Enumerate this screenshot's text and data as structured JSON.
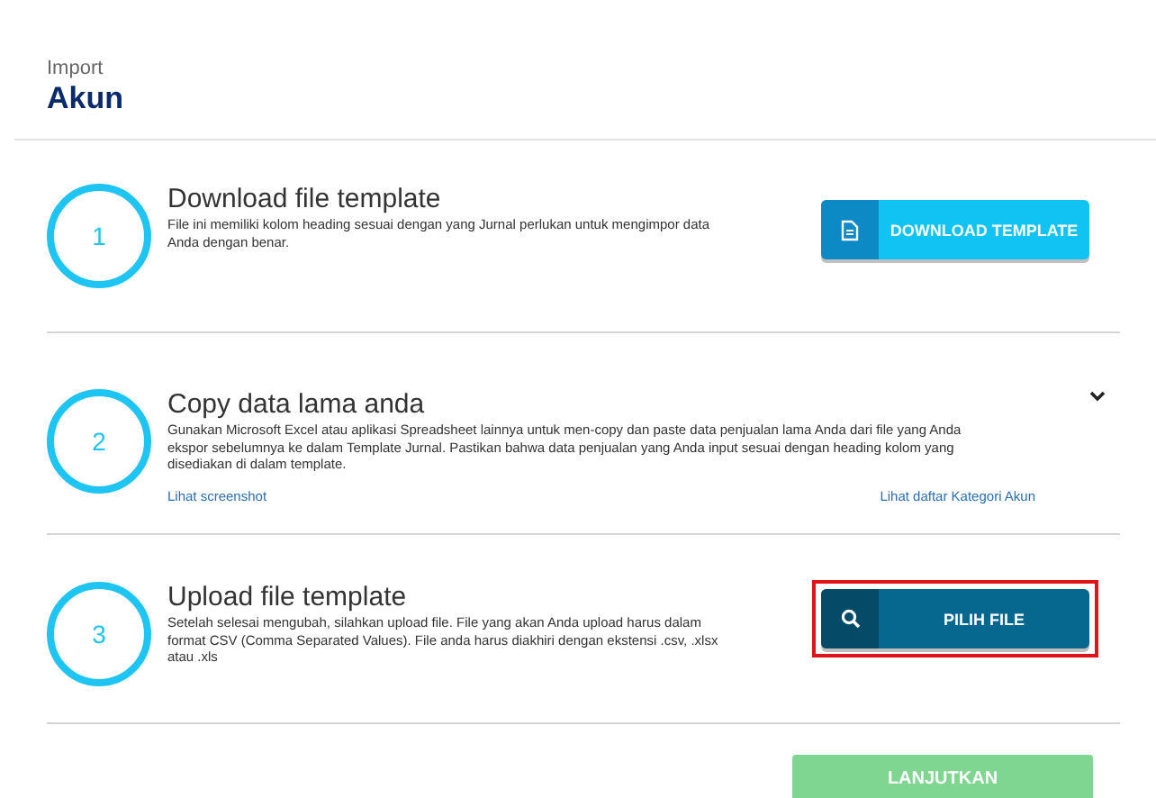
{
  "header": {
    "overline": "Import",
    "title": "Akun"
  },
  "steps": [
    {
      "number": "1",
      "title": "Download file template",
      "description": "File ini memiliki kolom heading sesuai dengan yang Jurnal perlukan untuk mengimpor data Anda dengan benar.",
      "action": {
        "kind": "download",
        "label": "DOWNLOAD TEMPLATE",
        "highlighted": false
      }
    },
    {
      "number": "2",
      "title": "Copy data lama anda",
      "description": "Gunakan Microsoft Excel atau aplikasi Spreadsheet lainnya untuk men-copy dan paste data penjualan lama Anda dari file yang Anda ekspor sebelumnya ke dalam Template Jurnal. Pastikan bahwa data penjualan yang Anda input sesuai dengan heading kolom yang disediakan di dalam template.",
      "links": [
        "Lihat screenshot",
        "Lihat daftar Kategori Akun"
      ],
      "expanded": false
    },
    {
      "number": "3",
      "title": "Upload file template",
      "description": "Setelah selesai mengubah, silahkan upload file. File yang akan Anda upload harus dalam format CSV (Comma Separated Values). File anda harus diakhiri dengan ekstensi .csv, .xlsx atau .xls",
      "action": {
        "kind": "upload",
        "label": "PILIH FILE",
        "highlighted": true
      }
    }
  ],
  "continue_button": {
    "label": "LANJUTKAN",
    "disabled": true
  }
}
